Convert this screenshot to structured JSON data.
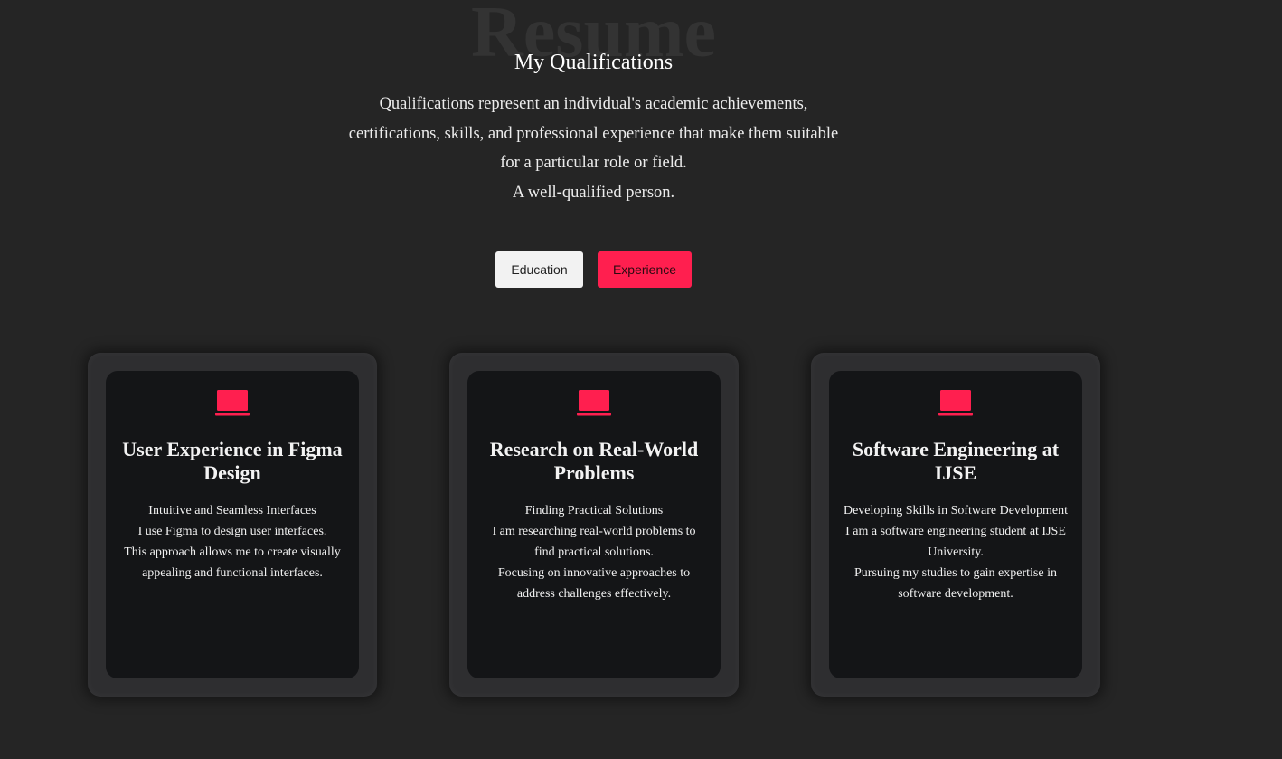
{
  "header": {
    "background_title": "Resume",
    "subtitle": "My Qualifications",
    "intro_lines": [
      "Qualifications represent an individual's academic achievements,",
      "certifications, skills, and professional experience that make them suitable",
      "for a particular role or field.",
      "A well-qualified person."
    ]
  },
  "tabs": {
    "education_label": "Education",
    "experience_label": "Experience"
  },
  "cards": [
    {
      "icon": "laptop-icon",
      "title": "User Experience in Figma Design",
      "lines": [
        "Intuitive and Seamless Interfaces",
        "I use Figma to design user interfaces.",
        "This approach allows me to create visually",
        "appealing and functional interfaces."
      ]
    },
    {
      "icon": "laptop-icon",
      "title": "Research on Real-World Problems",
      "lines": [
        "Finding Practical Solutions",
        "I am researching real-world problems to",
        "find practical solutions.",
        "Focusing on innovative approaches to",
        "address challenges effectively."
      ]
    },
    {
      "icon": "laptop-icon",
      "title": "Software Engineering at IJSE",
      "lines": [
        "Developing Skills in Software Development",
        "I am a software engineering student at IJSE",
        "University.",
        "Pursuing my studies to gain expertise in",
        "software development."
      ]
    }
  ],
  "colors": {
    "accent": "#ff1f4f",
    "background": "#252525",
    "card_outer": "#2e2e30",
    "card_inner": "#141517"
  }
}
